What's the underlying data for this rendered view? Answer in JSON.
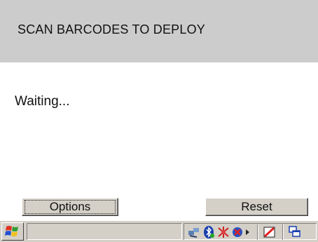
{
  "header": {
    "title": "SCAN BARCODES TO DEPLOY"
  },
  "main": {
    "status_text": "Waiting..."
  },
  "buttons": {
    "options_label": "Options",
    "reset_label": "Reset"
  },
  "taskbar": {
    "start_icon": "windows-flag-icon",
    "tray_icons": [
      "network-icon",
      "bluetooth-icon",
      "wireless-icon",
      "volume-icon",
      "arrow-icon",
      "input-panel-icon",
      "desktop-icon"
    ]
  },
  "colors": {
    "header_bg": "#cccccc",
    "system_gray": "#d4d0c8"
  }
}
